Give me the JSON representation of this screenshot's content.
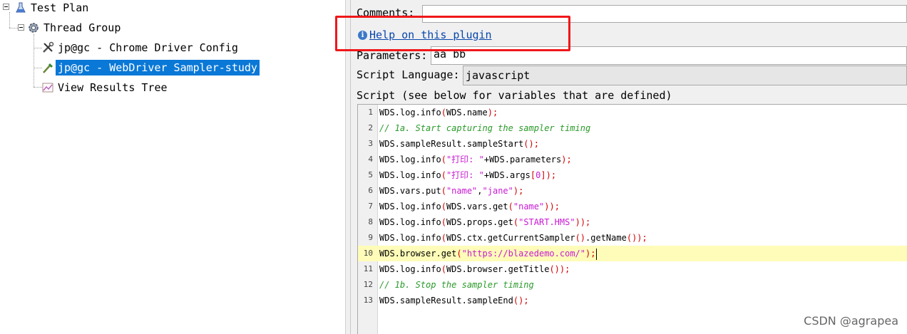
{
  "tree": {
    "nodes": [
      {
        "label": "Test Plan",
        "icon": "flask-icon",
        "expanded": true
      },
      {
        "label": "Thread Group",
        "icon": "gear-icon",
        "expanded": true
      },
      {
        "label": "jp@gc - Chrome Driver Config",
        "icon": "tools-icon"
      },
      {
        "label": "jp@gc - WebDriver Sampler-study",
        "icon": "pipette-icon",
        "selected": true
      },
      {
        "label": "View Results Tree",
        "icon": "chart-icon"
      }
    ]
  },
  "panel": {
    "comments_label": "Comments:",
    "comments_value": "",
    "help_link": "Help on this plugin",
    "parameters_label": "Parameters:",
    "parameters_value": "aa bb",
    "script_language_label": "Script Language:",
    "script_language_value": "javascript",
    "script_label": "Script (see below for variables that are defined)"
  },
  "editor": {
    "highlighted_line": 10,
    "lines": [
      {
        "no": "1",
        "code": "WDS.log.info(WDS.name);"
      },
      {
        "no": "2",
        "code": "// 1a. Start capturing the sampler timing"
      },
      {
        "no": "3",
        "code": "WDS.sampleResult.sampleStart();"
      },
      {
        "no": "4",
        "code": "WDS.log.info(\"打印: \"+WDS.parameters);"
      },
      {
        "no": "5",
        "code": "WDS.log.info(\"打印: \"+WDS.args[0]);"
      },
      {
        "no": "6",
        "code": "WDS.vars.put(\"name\",\"jane\");"
      },
      {
        "no": "7",
        "code": "WDS.log.info(WDS.vars.get(\"name\"));"
      },
      {
        "no": "8",
        "code": "WDS.log.info(WDS.props.get(\"START.HMS\"));"
      },
      {
        "no": "9",
        "code": "WDS.log.info(WDS.ctx.getCurrentSampler().getName());"
      },
      {
        "no": "10",
        "code": "WDS.browser.get(\"https://blazedemo.com/\");"
      },
      {
        "no": "11",
        "code": "WDS.log.info(WDS.browser.getTitle());"
      },
      {
        "no": "12",
        "code": "// 1b. Stop the sampler timing"
      },
      {
        "no": "13",
        "code": "WDS.sampleResult.sampleEnd();"
      }
    ]
  },
  "watermark": "CSDN @agrapea",
  "colors": {
    "selection": "#0a78d7",
    "highlight_box": "#f0171a",
    "line_highlight": "#fefcb8"
  }
}
